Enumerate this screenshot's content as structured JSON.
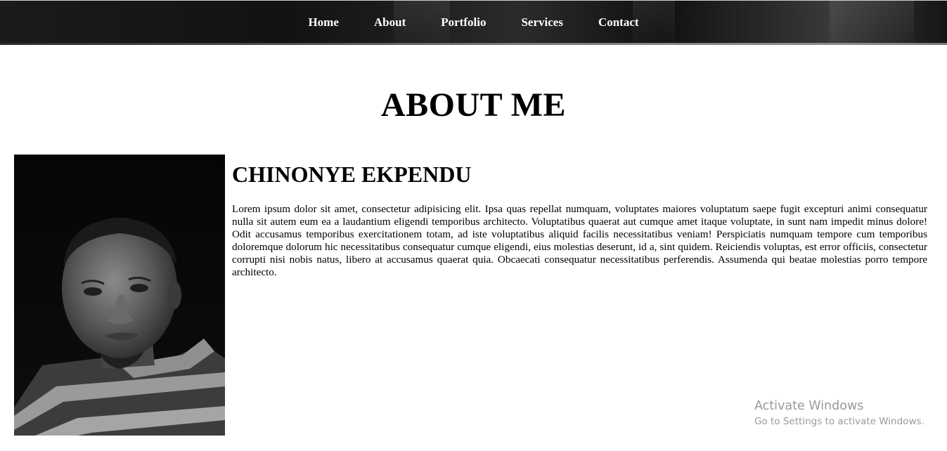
{
  "nav": {
    "items": [
      {
        "label": "Home"
      },
      {
        "label": "About"
      },
      {
        "label": "Portfolio"
      },
      {
        "label": "Services"
      },
      {
        "label": "Contact"
      }
    ]
  },
  "page": {
    "title": "ABOUT ME"
  },
  "profile": {
    "name": "CHINONYE EKPENDU",
    "bio": "Lorem ipsum dolor sit amet, consectetur adipisicing elit. Ipsa quas repellat numquam, voluptates maiores voluptatum saepe fugit excepturi animi consequatur nulla sit autem eum ea a laudantium eligendi temporibus architecto. Voluptatibus quaerat aut cumque amet itaque voluptate, in sunt nam impedit minus dolore! Odit accusamus temporibus exercitationem totam, ad iste voluptatibus aliquid facilis necessitatibus veniam! Perspiciatis numquam tempore cum temporibus doloremque dolorum hic necessitatibus consequatur cumque eligendi, eius molestias deserunt, id a, sint quidem. Reiciendis voluptas, est error officiis, consectetur corrupti nisi nobis natus, libero at accusamus quaerat quia. Obcaecati consequatur necessitatibus perferendis. Assumenda qui beatae molestias porro tempore architecto.",
    "photo_icon": "person-portrait"
  },
  "watermark": {
    "title": "Activate Windows",
    "subtitle": "Go to Settings to activate Windows."
  },
  "colors": {
    "navbar_bg": "#1a1a1a",
    "nav_text": "#ffffff",
    "page_bg": "#ffffff",
    "text": "#000000",
    "watermark": "#9a9a9a"
  }
}
